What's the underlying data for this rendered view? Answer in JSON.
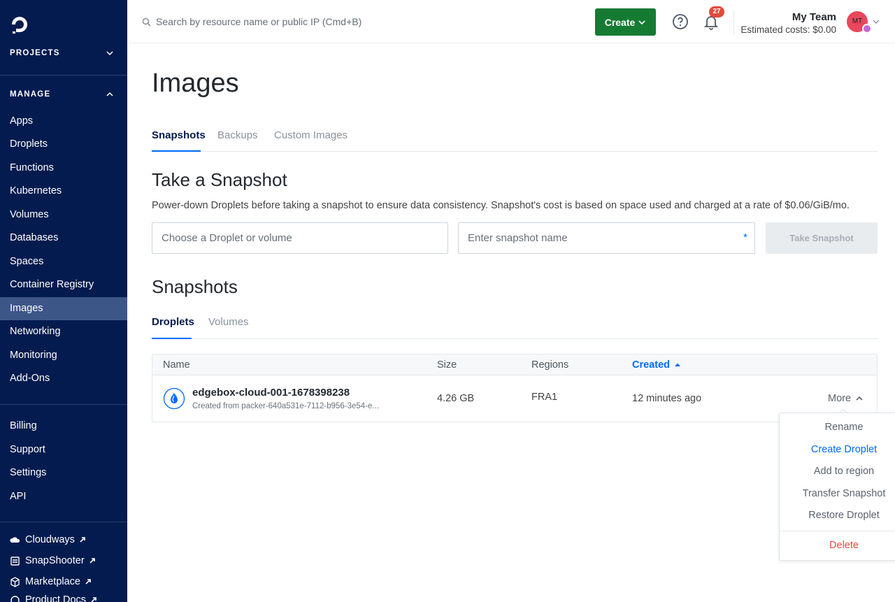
{
  "sidebar": {
    "projects_label": "PROJECTS",
    "manage_label": "MANAGE",
    "nav": [
      "Apps",
      "Droplets",
      "Functions",
      "Kubernetes",
      "Volumes",
      "Databases",
      "Spaces",
      "Container Registry",
      "Images",
      "Networking",
      "Monitoring",
      "Add-Ons"
    ],
    "active_item": "Images",
    "account": [
      "Billing",
      "Support",
      "Settings",
      "API"
    ],
    "external": [
      "Cloudways",
      "SnapShooter",
      "Marketplace",
      "Product Docs"
    ]
  },
  "topbar": {
    "search_placeholder": "Search by resource name or public IP (Cmd+B)",
    "create_label": "Create",
    "notification_count": "27",
    "team_name": "My Team",
    "estimated_costs": "Estimated costs: $0.00",
    "avatar_initials": "MT"
  },
  "page": {
    "title": "Images",
    "tabs": [
      "Snapshots",
      "Backups",
      "Custom Images"
    ],
    "active_tab": "Snapshots",
    "take_snapshot_title": "Take a Snapshot",
    "take_snapshot_help": "Power-down Droplets before taking a snapshot to ensure data consistency. Snapshot's cost is based on space used and charged at a rate of $0.06/GiB/mo.",
    "droplet_placeholder": "Choose a Droplet or volume",
    "name_placeholder": "Enter snapshot name",
    "required_mark": "*",
    "take_snapshot_button": "Take Snapshot",
    "snapshots_title": "Snapshots",
    "sub_tabs": [
      "Droplets",
      "Volumes"
    ],
    "active_sub_tab": "Droplets"
  },
  "table": {
    "columns": [
      "Name",
      "Size",
      "Regions",
      "Created"
    ],
    "sorted_column": "Created",
    "rows": [
      {
        "name": "edgebox-cloud-001-1678398238",
        "subtitle": "Created from packer-640a531e-7112-b956-3e54-e...",
        "size": "4.26 GB",
        "region": "FRA1",
        "created": "12 minutes ago",
        "action_label": "More"
      }
    ]
  },
  "dropdown": {
    "items": [
      "Rename",
      "Create Droplet",
      "Add to region",
      "Transfer Snapshot",
      "Restore Droplet"
    ],
    "danger_item": "Delete"
  },
  "colors": {
    "sidebar_bg": "#031b4e",
    "sidebar_active": "#3d5688",
    "accent_blue": "#0069ff",
    "create_green": "#157b33",
    "danger_red": "#e14b3c"
  }
}
